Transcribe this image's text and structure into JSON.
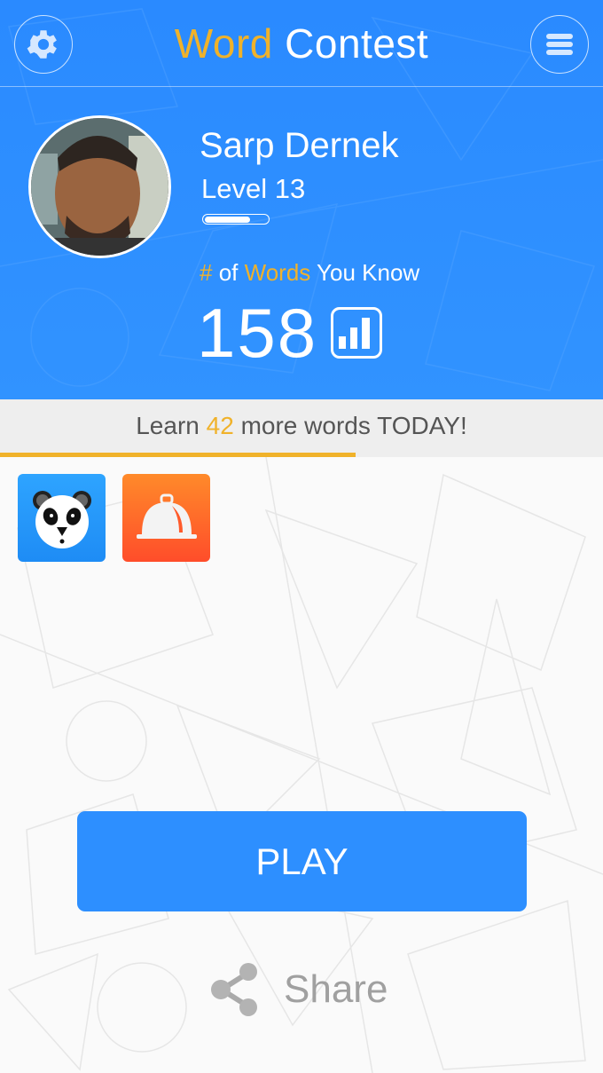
{
  "header": {
    "title_accent": "Word",
    "title_rest": "Contest",
    "settings_icon": "gear-icon",
    "menu_icon": "hamburger-menu-icon"
  },
  "profile": {
    "name": "Sarp Dernek",
    "level_label": "Level 13",
    "level_progress": 0.72,
    "words_label_hash": "#",
    "words_label_of": "of",
    "words_label_words": "Words",
    "words_label_rest": "You Know",
    "words_count": "158",
    "stats_icon": "bar-chart-icon"
  },
  "daily_goal": {
    "prefix": "Learn",
    "count": "42",
    "suffix": "more words TODAY!",
    "progress": 0.59
  },
  "modes": [
    {
      "name": "panda-mode",
      "icon": "panda-icon"
    },
    {
      "name": "cloche-mode",
      "icon": "food-cloche-icon"
    }
  ],
  "actions": {
    "play_label": "PLAY",
    "share_label": "Share",
    "share_icon": "share-icon"
  },
  "colors": {
    "primary_blue": "#2d8fff",
    "accent_yellow": "#f0b22a",
    "panda_tile": "#1e8cf5",
    "cloche_tile": "#ff5a2a"
  }
}
